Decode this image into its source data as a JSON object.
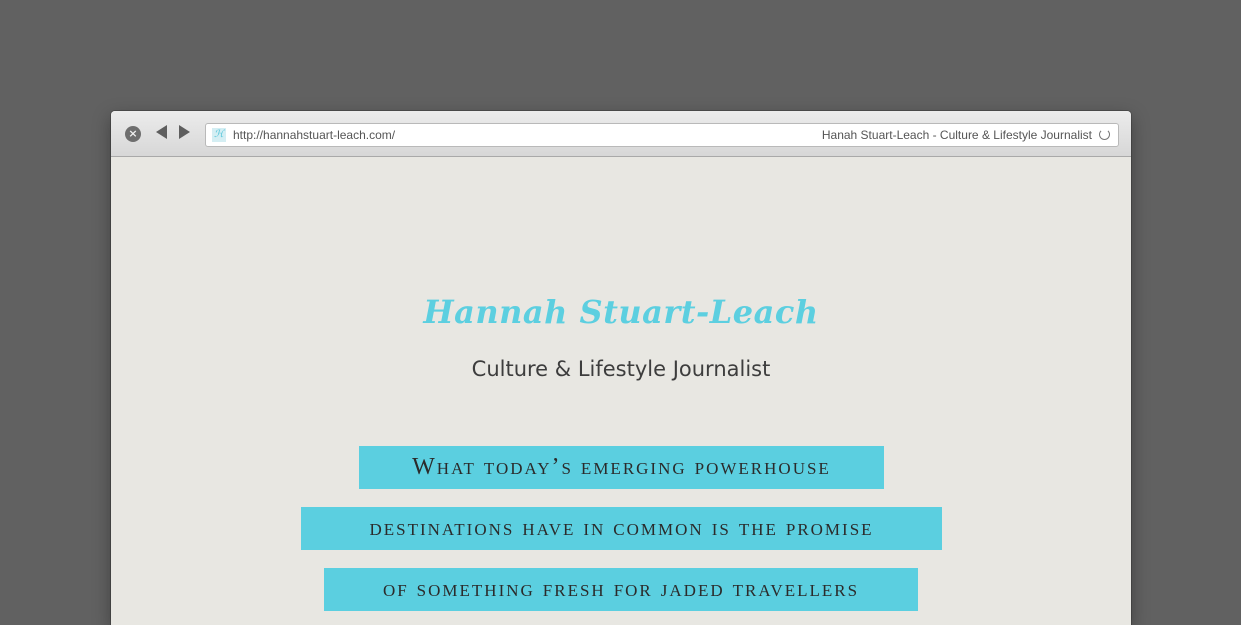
{
  "browser": {
    "url": "http://hannahstuart-leach.com/",
    "page_title": "Hanah Stuart-Leach - Culture & Lifestyle Journalist",
    "favicon_glyph": "ℋ",
    "close_glyph": "×"
  },
  "header": {
    "site_name": "Hannah Stuart-Leach",
    "tagline": "Culture & Lifestyle Journalist"
  },
  "quote": {
    "lines": [
      "What today’s emerging powerhouse",
      "destinations have in common is the promise",
      "of something fresh for jaded travellers"
    ],
    "highlight_color": "#5bcfe0"
  },
  "colors": {
    "accent": "#5ccfe0",
    "page_background": "#e8e7e2",
    "desktop_background": "#616161"
  }
}
